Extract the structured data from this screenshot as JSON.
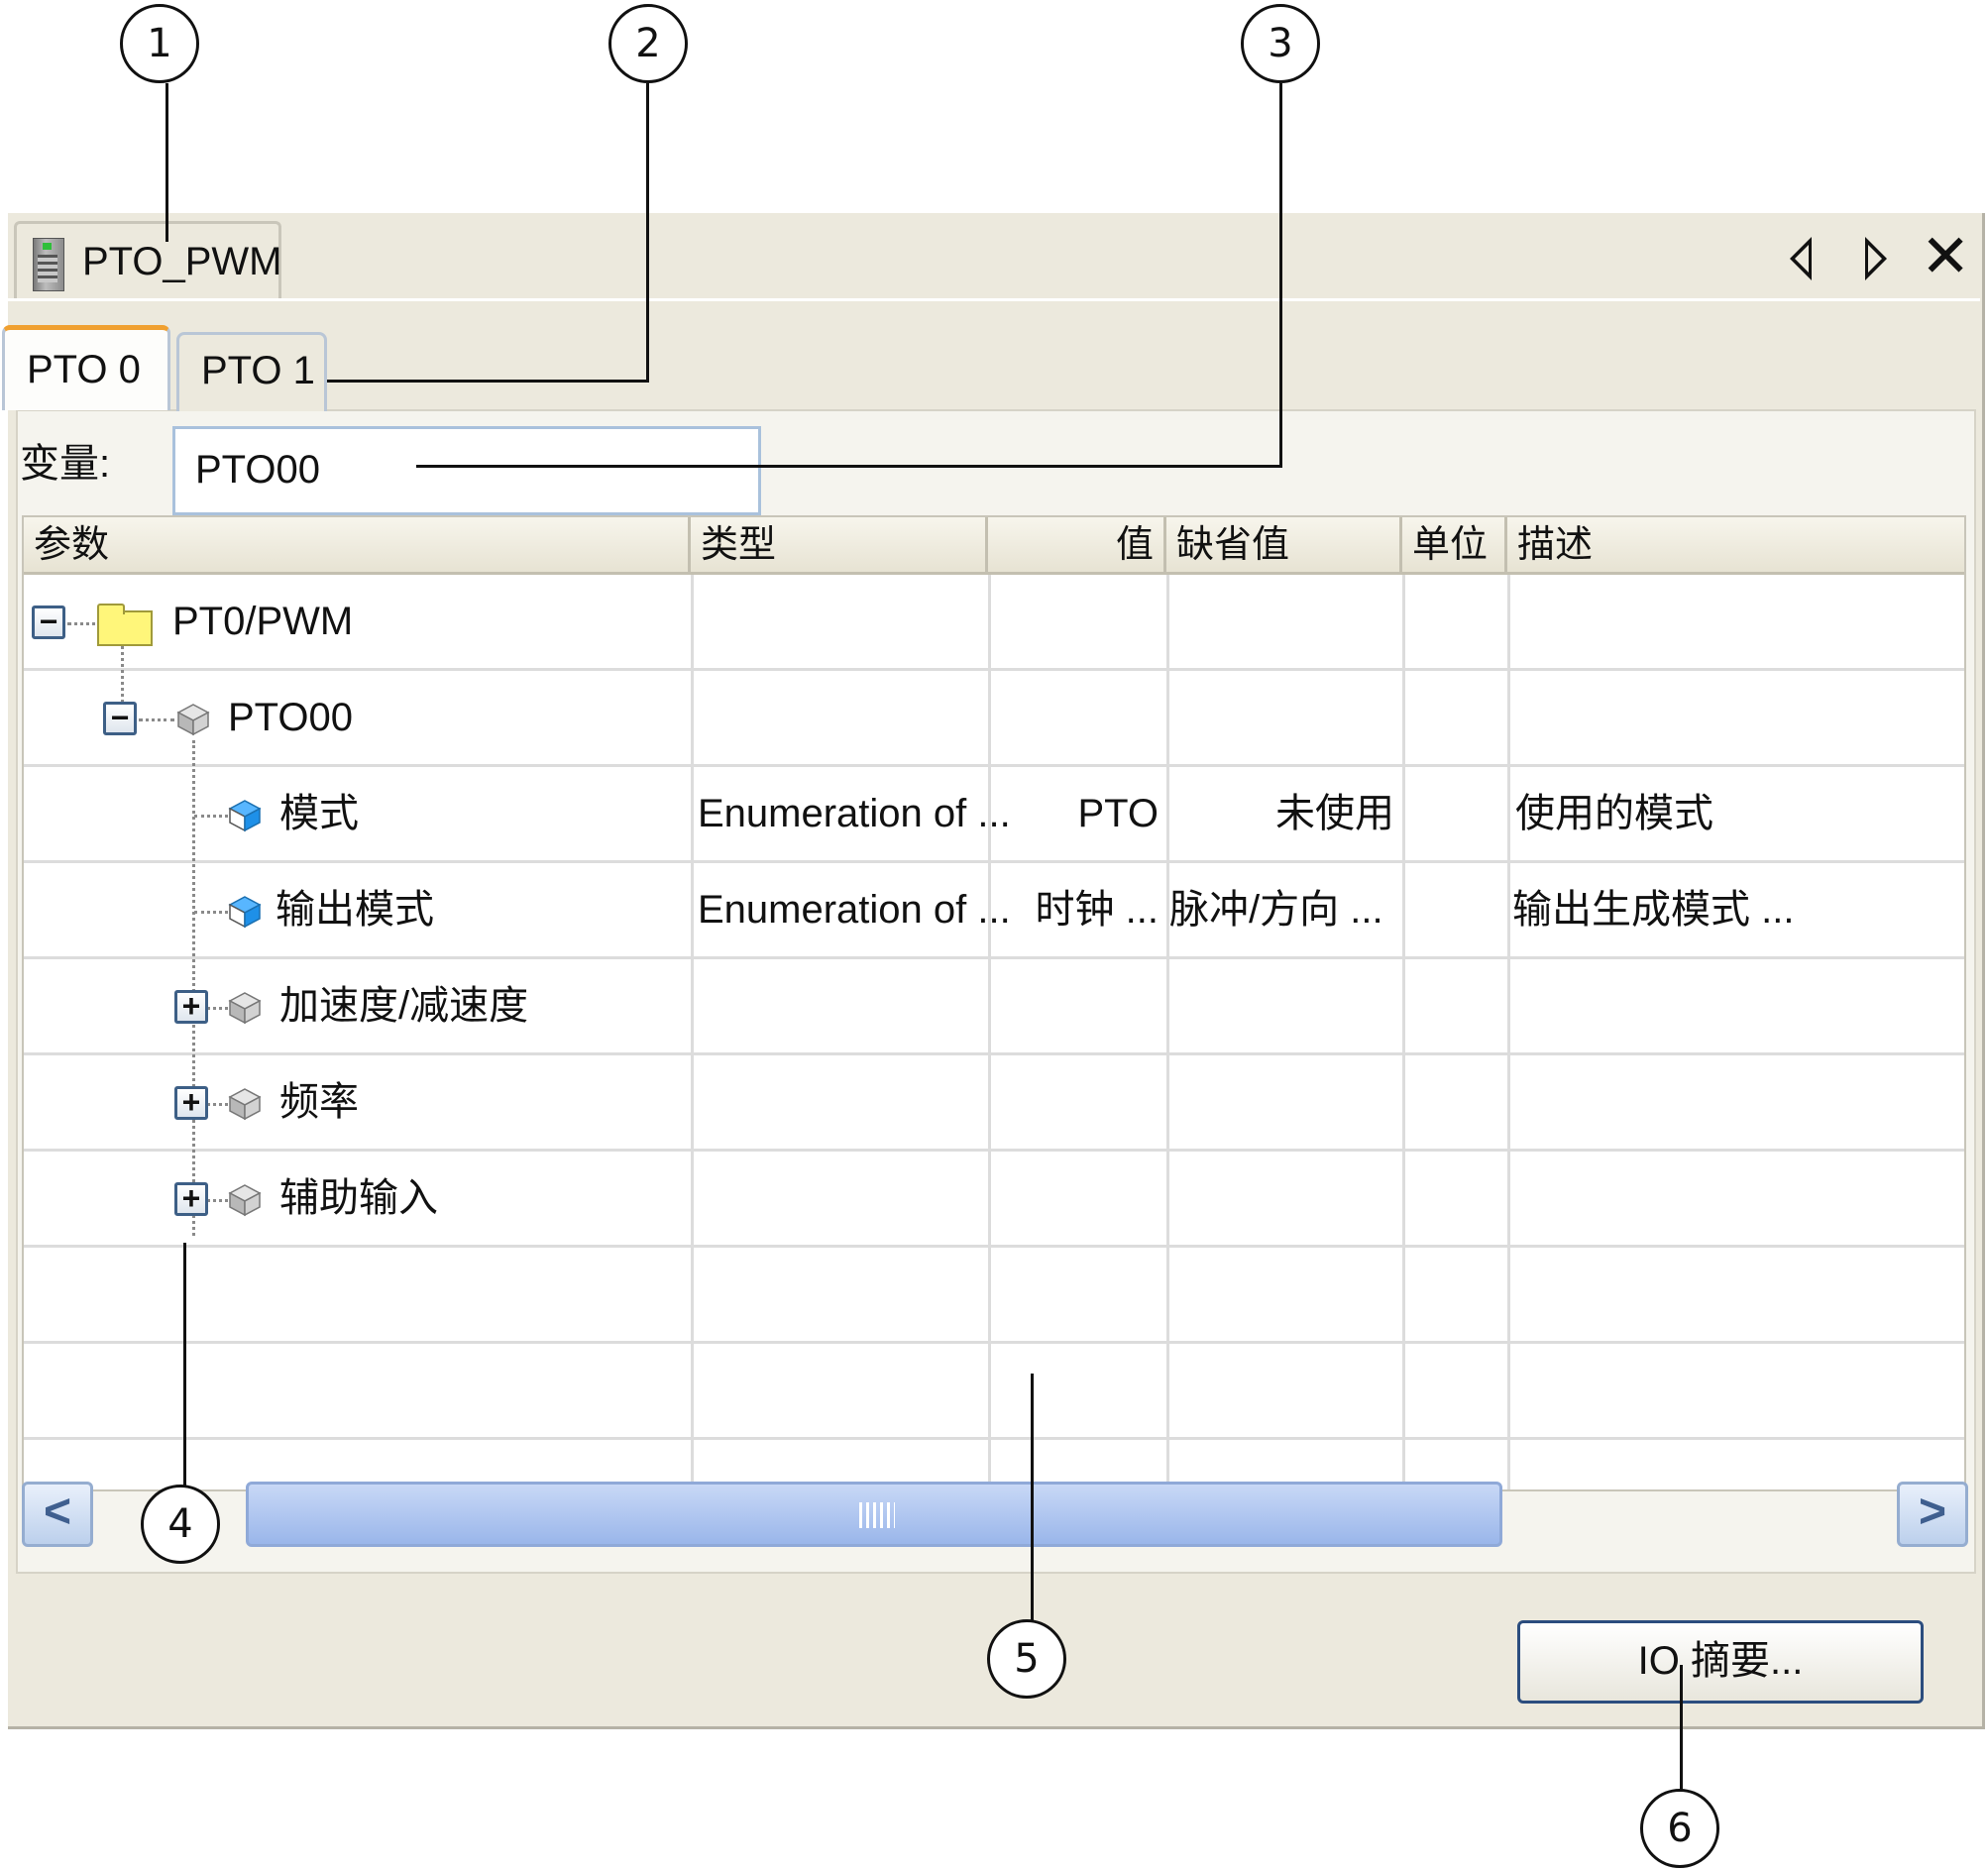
{
  "window": {
    "tab_title": "PTO_PWM",
    "prev_icon": "triangle-left-icon",
    "next_icon": "triangle-right-icon",
    "close_icon": "close-x-icon",
    "close_label": "✕"
  },
  "tabs": [
    {
      "label": "PTO 0",
      "active": true
    },
    {
      "label": "PTO 1",
      "active": false
    }
  ],
  "variable": {
    "label": "变量:",
    "value": "PTO00"
  },
  "columns": [
    "参数",
    "类型",
    "值",
    "缺省值",
    "单位",
    "描述"
  ],
  "rows": [
    {
      "name": "PT0/PWM",
      "type": "",
      "value": "",
      "default": "",
      "unit": "",
      "description": "",
      "expander": "−"
    },
    {
      "name": "PTO00",
      "type": "",
      "value": "",
      "default": "",
      "unit": "",
      "description": "",
      "expander": "−"
    },
    {
      "name": "模式",
      "type": "Enumeration of ...",
      "value": "PTO",
      "default": "未使用",
      "unit": "",
      "description": "使用的模式"
    },
    {
      "name": "输出模式",
      "type": "Enumeration of ...",
      "value": "时钟 ...",
      "default": "脉冲/方向 ...",
      "unit": "",
      "description": "输出生成模式 ..."
    },
    {
      "name": "加速度/减速度",
      "type": "",
      "value": "",
      "default": "",
      "unit": "",
      "description": "",
      "expander": "+"
    },
    {
      "name": "频率",
      "type": "",
      "value": "",
      "default": "",
      "unit": "",
      "description": "",
      "expander": "+"
    },
    {
      "name": "辅助输入",
      "type": "",
      "value": "",
      "default": "",
      "unit": "",
      "description": "",
      "expander": "+"
    }
  ],
  "scrollbar": {
    "left": "<",
    "right": ">"
  },
  "io_summary_button": "IO 摘要...",
  "callouts": [
    "1",
    "2",
    "3",
    "4",
    "5",
    "6"
  ],
  "colors": {
    "active_tab_accent": "#f0a030",
    "button_border": "#2b4d7e",
    "parameter_icon": "#1e90e8"
  }
}
